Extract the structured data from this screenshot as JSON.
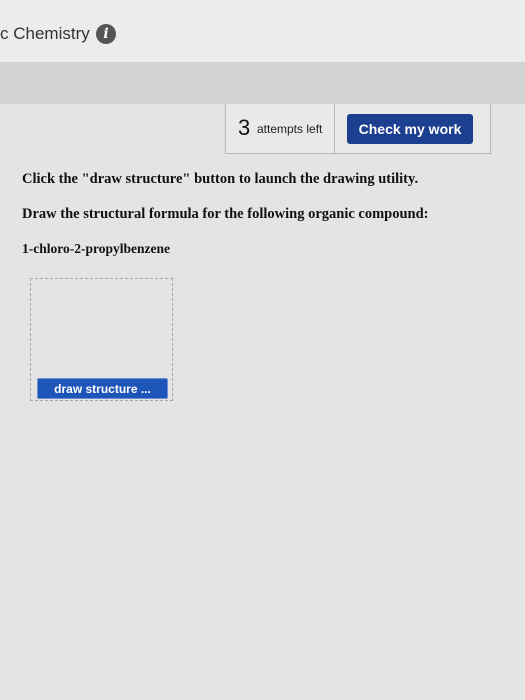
{
  "header": {
    "title": "c Chemistry",
    "info_icon": "info-icon"
  },
  "attempts": {
    "count": "3",
    "label": "attempts left"
  },
  "actions": {
    "check_label": "Check my work"
  },
  "question": {
    "instruction_1": "Click the \"draw structure\" button to launch the drawing utility.",
    "instruction_2": "Draw the structural formula for the following organic compound:",
    "compound": "1-chloro-2-propylbenzene",
    "draw_button_label": "draw structure ..."
  },
  "colors": {
    "check_button": "#1d3f8f",
    "draw_button": "#1e55b8"
  }
}
